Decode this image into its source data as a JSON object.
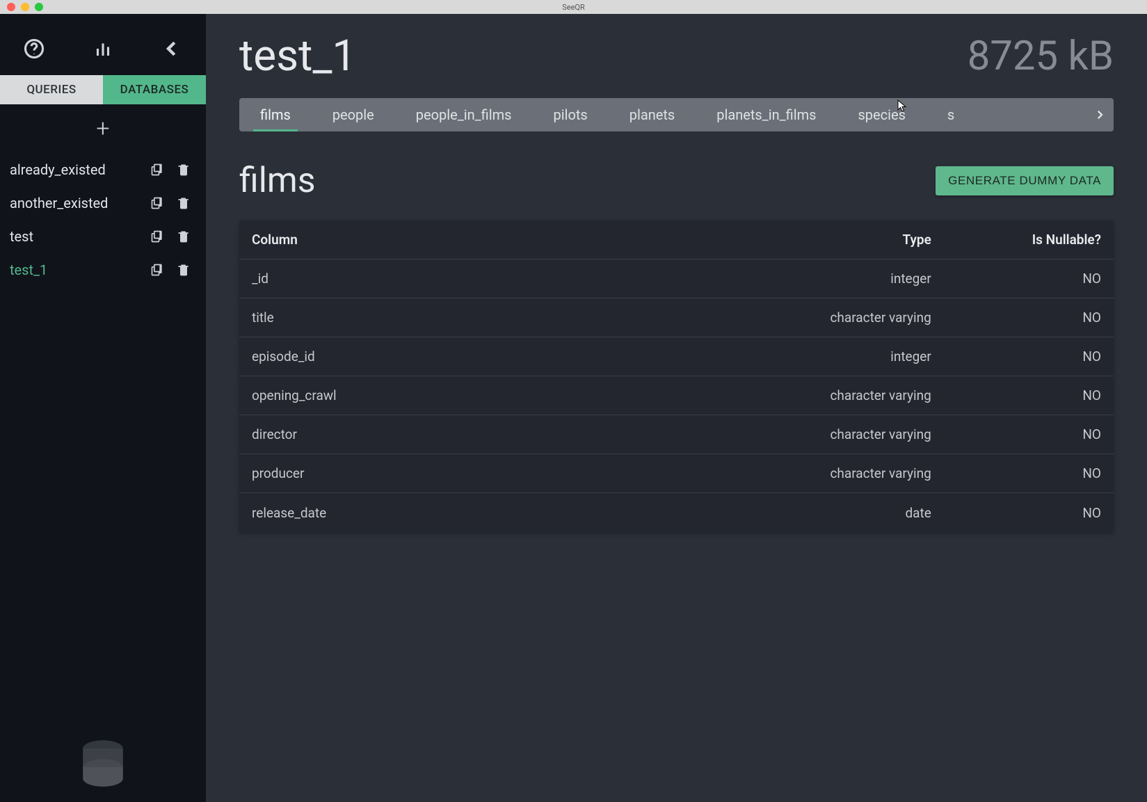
{
  "window": {
    "title": "SeeQR"
  },
  "sidebar": {
    "tabs": {
      "queries": "QUERIES",
      "databases": "DATABASES"
    },
    "databases": [
      {
        "name": "already_existed",
        "active": false
      },
      {
        "name": "another_existed",
        "active": false
      },
      {
        "name": "test",
        "active": false
      },
      {
        "name": "test_1",
        "active": true
      }
    ]
  },
  "main": {
    "db_name": "test_1",
    "db_size": "8725 kB",
    "generate_label": "GENERATE DUMMY DATA",
    "table_tabs": [
      "films",
      "people",
      "people_in_films",
      "pilots",
      "planets",
      "planets_in_films",
      "species",
      "s"
    ],
    "active_tab": "films",
    "current_table": "films",
    "columns_header": {
      "col": "Column",
      "type": "Type",
      "nullable": "Is Nullable?"
    },
    "columns": [
      {
        "name": "_id",
        "type": "integer",
        "nullable": "NO"
      },
      {
        "name": "title",
        "type": "character varying",
        "nullable": "NO"
      },
      {
        "name": "episode_id",
        "type": "integer",
        "nullable": "NO"
      },
      {
        "name": "opening_crawl",
        "type": "character varying",
        "nullable": "NO"
      },
      {
        "name": "director",
        "type": "character varying",
        "nullable": "NO"
      },
      {
        "name": "producer",
        "type": "character varying",
        "nullable": "NO"
      },
      {
        "name": "release_date",
        "type": "date",
        "nullable": "NO"
      }
    ]
  }
}
